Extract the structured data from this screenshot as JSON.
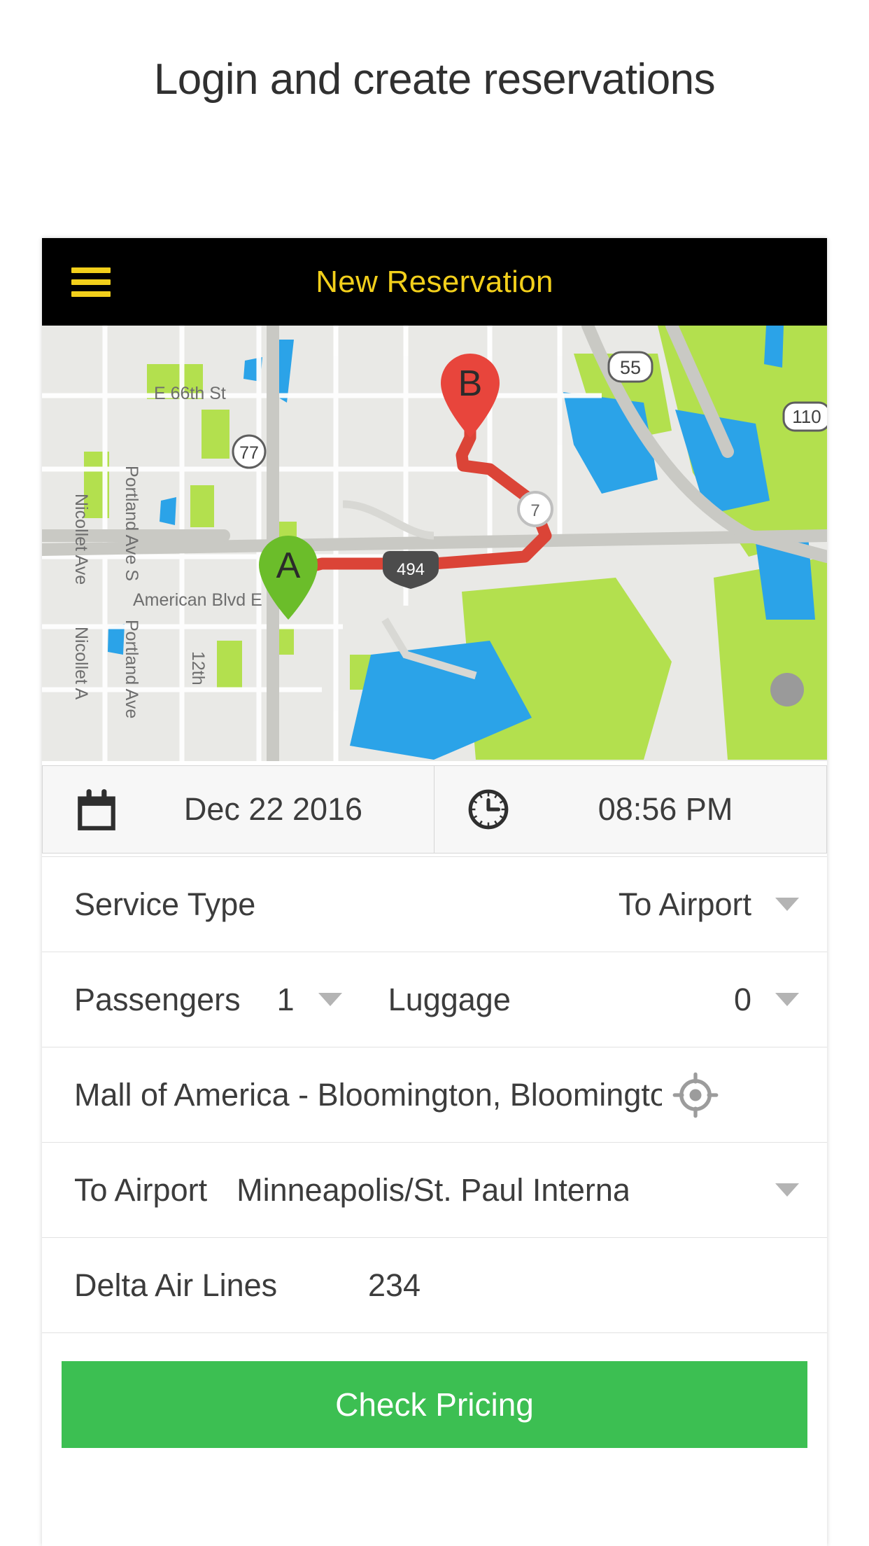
{
  "page": {
    "title": "Login and create reservations"
  },
  "appbar": {
    "menu_icon": "hamburger-menu-icon",
    "title": "New Reservation"
  },
  "map": {
    "origin_marker": "A",
    "destination_marker": "B",
    "origin_marker_color": "#6BBD2A",
    "destination_marker_color": "#E8453C",
    "route_color": "#DB4437",
    "labels": [
      "E 66th St",
      "Nicollet Ave",
      "Portland Ave S",
      "Nicollet A",
      "Portland Ave",
      "American Blvd E",
      "12th"
    ],
    "shields": [
      "55",
      "77",
      "110",
      "494"
    ]
  },
  "datetime": {
    "date_icon": "calendar-icon",
    "date_value": "Dec 22 2016",
    "time_icon": "clock-icon",
    "time_value": "08:56 PM"
  },
  "form": {
    "service_type": {
      "label": "Service Type",
      "value": "To Airport"
    },
    "passengers": {
      "label": "Passengers",
      "value": "1"
    },
    "luggage": {
      "label": "Luggage",
      "value": "0"
    },
    "pickup": {
      "value": "Mall of America - Bloomington, Bloomington, M",
      "locate_icon": "gps-crosshair-icon"
    },
    "airport": {
      "label": "To Airport",
      "value": "Minneapolis/St. Paul Interna"
    },
    "airline": {
      "label": "Delta Air Lines",
      "flight_number": "234"
    }
  },
  "cta": {
    "label": "Check Pricing",
    "color": "#3CBF52"
  }
}
